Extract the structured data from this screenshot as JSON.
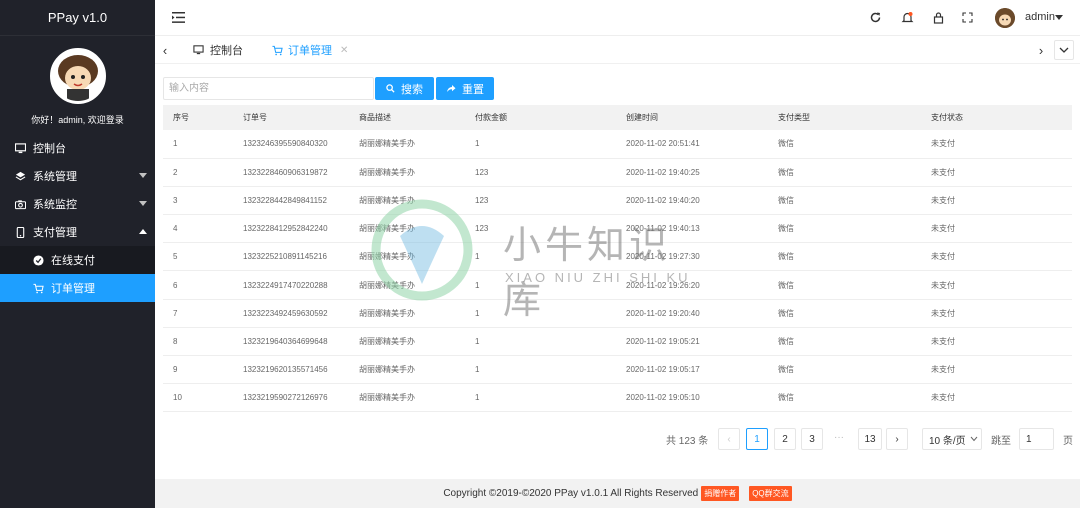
{
  "app": {
    "title": "PPay v1.0"
  },
  "profile": {
    "welcome": "你好！admin, 欢迎登录",
    "avatar_icon": "cartoon-avatar"
  },
  "sidebar": {
    "items": [
      {
        "label": "控制台",
        "icon": "monitor-icon"
      },
      {
        "label": "系统管理",
        "icon": "layers-icon"
      },
      {
        "label": "系统监控",
        "icon": "camera-icon"
      },
      {
        "label": "支付管理",
        "icon": "phone-icon"
      }
    ],
    "subitems": [
      {
        "label": "在线支付",
        "icon": "circle-icon"
      },
      {
        "label": "订单管理",
        "icon": "cart-icon"
      }
    ]
  },
  "header": {
    "username": "admin"
  },
  "tabs": [
    {
      "label": "控制台"
    },
    {
      "label": "订单管理"
    }
  ],
  "search": {
    "placeholder": "输入内容",
    "search_label": "搜索",
    "reset_label": "重置"
  },
  "table": {
    "columns": [
      "序号",
      "订单号",
      "商品描述",
      "付款金额",
      "创建时间",
      "支付类型",
      "支付状态"
    ],
    "rows": [
      [
        "1",
        "1323246395590840320",
        "胡丽娜精美手办",
        "1",
        "2020-11-02 20:51:41",
        "微信",
        "未支付"
      ],
      [
        "2",
        "1323228460906319872",
        "胡丽娜精美手办",
        "123",
        "2020-11-02 19:40:25",
        "微信",
        "未支付"
      ],
      [
        "3",
        "1323228442849841152",
        "胡丽娜精美手办",
        "123",
        "2020-11-02 19:40:20",
        "微信",
        "未支付"
      ],
      [
        "4",
        "1323228412952842240",
        "胡丽娜精美手办",
        "123",
        "2020-11-02 19:40:13",
        "微信",
        "未支付"
      ],
      [
        "5",
        "1323225210891145216",
        "胡丽娜精美手办",
        "1",
        "2020-11-02 19:27:30",
        "微信",
        "未支付"
      ],
      [
        "6",
        "1323224917470220288",
        "胡丽娜精美手办",
        "1",
        "2020-11-02 19:26:20",
        "微信",
        "未支付"
      ],
      [
        "7",
        "1323223492459630592",
        "胡丽娜精美手办",
        "1",
        "2020-11-02 19:20:40",
        "微信",
        "未支付"
      ],
      [
        "8",
        "1323219640364699648",
        "胡丽娜精美手办",
        "1",
        "2020-11-02 19:05:21",
        "微信",
        "未支付"
      ],
      [
        "9",
        "1323219620135571456",
        "胡丽娜精美手办",
        "1",
        "2020-11-02 19:05:17",
        "微信",
        "未支付"
      ],
      [
        "10",
        "1323219590272126976",
        "胡丽娜精美手办",
        "1",
        "2020-11-02 19:05:10",
        "微信",
        "未支付"
      ]
    ]
  },
  "pagination": {
    "total": "共 123 条",
    "pages": [
      "1",
      "2",
      "3",
      "13"
    ],
    "ellipsis": "···",
    "current": "1",
    "page_size": "10 条/页",
    "jump_label": "跳至",
    "jump_value": "1",
    "page_unit": "页"
  },
  "footer": {
    "copyright": "Copyright ©2019-©2020 PPay v1.0.1 All Rights Reserved",
    "badge1": "捐赠作者",
    "badge2": "QQ群交流"
  },
  "watermark": {
    "title": "小牛知识库",
    "subtitle": "XIAO NIU ZHI SHI KU"
  },
  "colors": {
    "accent": "#1e9fff",
    "sidebar": "#20222a",
    "badge": "#ff5722"
  }
}
